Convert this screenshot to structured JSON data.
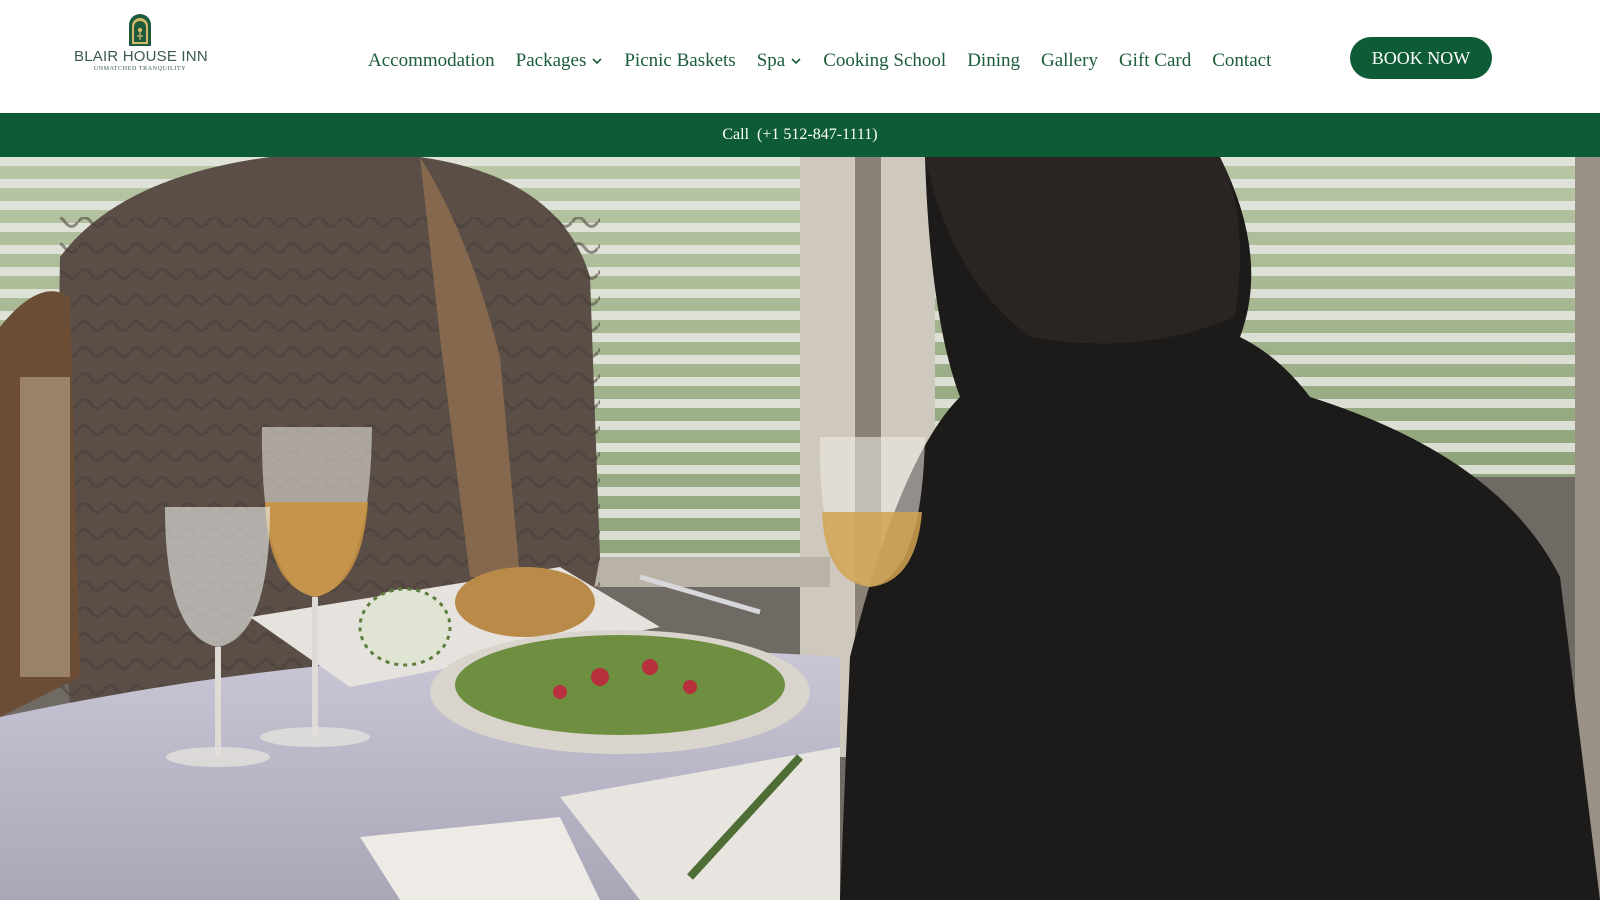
{
  "brand": {
    "name": "BLAIR HOUSE INN",
    "tagline": "UNMATCHED TRANQUILITY",
    "color": "#0e5c37"
  },
  "nav": {
    "items": [
      {
        "label": "Accommodation",
        "dropdown": false
      },
      {
        "label": "Packages",
        "dropdown": true,
        "icon": "chevron-down-icon"
      },
      {
        "label": "Picnic Baskets",
        "dropdown": false
      },
      {
        "label": "Spa",
        "dropdown": true,
        "icon": "chevron-down-icon"
      },
      {
        "label": "Cooking School",
        "dropdown": false
      },
      {
        "label": "Dining",
        "dropdown": false
      },
      {
        "label": "Gallery",
        "dropdown": false
      },
      {
        "label": "Gift Card",
        "dropdown": false
      },
      {
        "label": "Contact",
        "dropdown": false
      }
    ]
  },
  "cta": {
    "book_label": "BOOK NOW"
  },
  "callbar": {
    "label": "Call",
    "phone": "(+1 512-847-1111)"
  },
  "hero": {
    "type": "photo",
    "subject": "dining-scene"
  }
}
